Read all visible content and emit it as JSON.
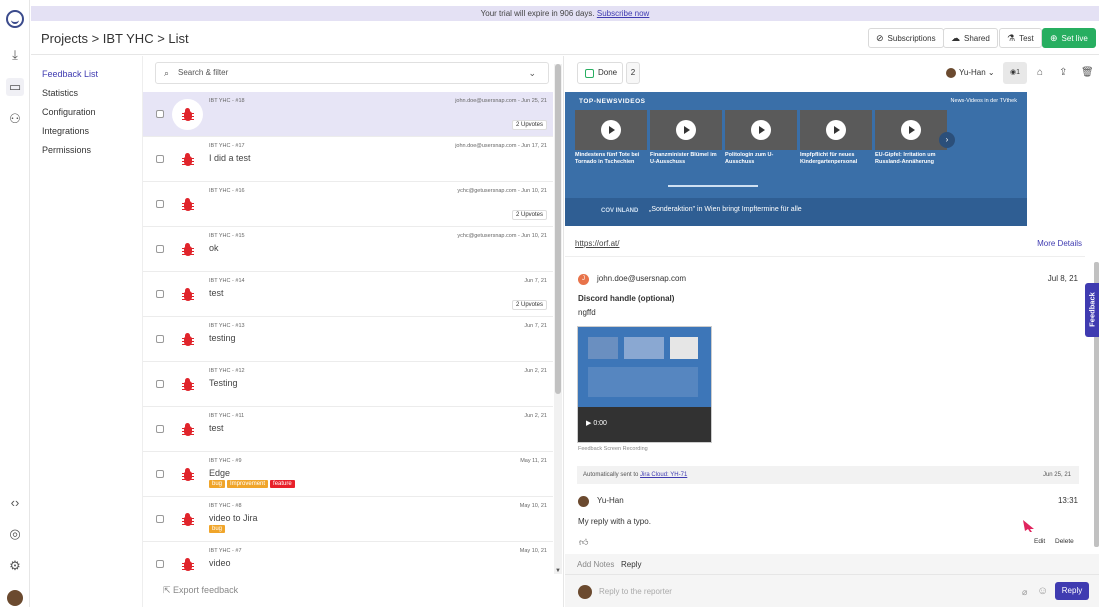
{
  "banner": {
    "text": "Your trial will expire in 906 days.",
    "link": "Subscribe now"
  },
  "header": {
    "breadcrumb": "Projects > IBT YHC > List",
    "buttons": {
      "subscriptions": "Subscriptions",
      "shared": "Shared",
      "test": "Test",
      "set_live": "Set live"
    }
  },
  "nav": {
    "items": [
      "Feedback List",
      "Statistics",
      "Configuration",
      "Integrations",
      "Permissions"
    ]
  },
  "list": {
    "search_placeholder": "Search & filter",
    "export": "Export feedback",
    "rows": [
      {
        "meta": "IBT YHC - #18",
        "title": "",
        "mail": "john.doe@usersnap.com - Jun 25, 21",
        "upvotes": "2 Upvotes"
      },
      {
        "meta": "IBT YHC - #17",
        "title": "I did a test",
        "mail": "john.doe@usersnap.com - Jun 17, 21",
        "upvotes": ""
      },
      {
        "meta": "IBT YHC - #16",
        "title": "",
        "mail": "ychc@getusersnap.com - Jun 10, 21",
        "upvotes": "2 Upvotes"
      },
      {
        "meta": "IBT YHC - #15",
        "title": "ok",
        "mail": "ychc@getusersnap.com - Jun 10, 21",
        "upvotes": ""
      },
      {
        "meta": "IBT YHC - #14",
        "title": "test",
        "mail": "Jun 7, 21",
        "upvotes": "2 Upvotes"
      },
      {
        "meta": "IBT YHC - #13",
        "title": "testing",
        "mail": "Jun 7, 21",
        "upvotes": ""
      },
      {
        "meta": "IBT YHC - #12",
        "title": "Testing",
        "mail": "Jun 2, 21",
        "upvotes": ""
      },
      {
        "meta": "IBT YHC - #11",
        "title": "test",
        "mail": "Jun 2, 21",
        "upvotes": ""
      },
      {
        "meta": "IBT YHC - #9",
        "title": "Edge",
        "mail": "May 11, 21",
        "upvotes": ""
      },
      {
        "meta": "IBT YHC - #8",
        "title": "video to Jira",
        "mail": "May 10, 21",
        "upvotes": ""
      },
      {
        "meta": "IBT YHC - #7",
        "title": "video",
        "mail": "May 10, 21",
        "upvotes": ""
      }
    ],
    "tags_edge": [
      "bug",
      "Improvement",
      "feature"
    ],
    "tags_video": [
      "bug"
    ]
  },
  "detail": {
    "status": "Done",
    "count": "2",
    "assignee": "Yu-Han",
    "views": "1",
    "screenshot": {
      "heading": "TOP-NEWSVIDEOS",
      "heading_right": "News-Videos in der TVthek",
      "videos": [
        "Mindestens fünf Tote bei Tornado in Tschechien",
        "Finanzminister Blümel im U-Ausschuss",
        "Politologin zum U-Ausschuss",
        "Impfpflicht für neues Kindergartenpersonal",
        "EU-Gipfel: Irritation um Russland-Annäherung"
      ],
      "cov": "COV INLAND",
      "cov_text": "„Sonderaktion\" in Wien bringt Impftermine für alle"
    },
    "url": "https://orf.at/",
    "more": "More Details",
    "comment": {
      "user": "john.doe@usersnap.com",
      "initial": "J",
      "date": "Jul 8, 21",
      "label": "Discord handle (optional)",
      "value": "ngffd",
      "recording_time": "0:00",
      "recording_caption": "Feedback Screen Recording"
    },
    "auto": {
      "text": "Automatically sent to",
      "link": "Jira Cloud: YH-71",
      "date": "Jun 25, 21"
    },
    "reply": {
      "user": "Yu-Han",
      "time": "13:31",
      "text": "My reply with a typo.",
      "edit": "Edit",
      "delete": "Delete"
    },
    "tabs": [
      "Add Notes",
      "Reply"
    ],
    "composer": {
      "placeholder": "Reply to the reporter",
      "button": "Reply"
    }
  },
  "feedback_tab": "Feedback"
}
